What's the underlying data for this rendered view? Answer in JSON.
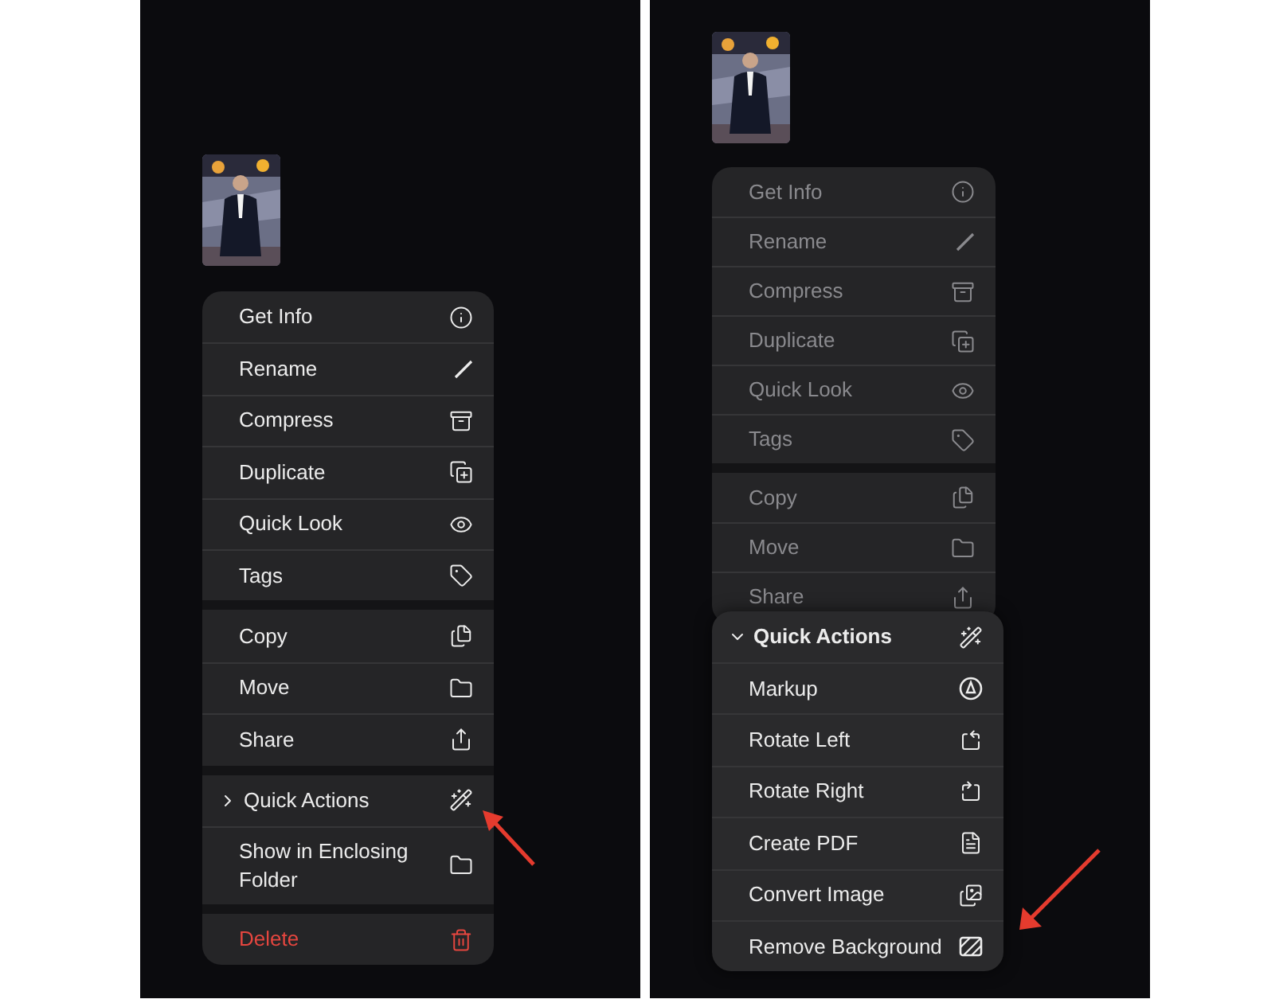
{
  "panels": [
    {
      "menu": {
        "dimmed": false,
        "groups": [
          [
            {
              "label": "Get Info",
              "kind": "action"
            },
            {
              "label": "Rename",
              "kind": "action"
            },
            {
              "label": "Compress",
              "kind": "action"
            },
            {
              "label": "Duplicate",
              "kind": "action"
            },
            {
              "label": "Quick Look",
              "kind": "action"
            },
            {
              "label": "Tags",
              "kind": "action"
            }
          ],
          [
            {
              "label": "Copy",
              "kind": "action"
            },
            {
              "label": "Move",
              "kind": "action"
            },
            {
              "label": "Share",
              "kind": "action"
            }
          ],
          [
            {
              "label": "Quick Actions",
              "kind": "submenu",
              "expanded": false
            },
            {
              "label": "Show in Enclosing Folder",
              "kind": "action"
            }
          ],
          [
            {
              "label": "Delete",
              "kind": "destructive"
            }
          ]
        ]
      }
    },
    {
      "menu": {
        "dimmed": true,
        "groups": [
          [
            {
              "label": "Get Info",
              "kind": "action"
            },
            {
              "label": "Rename",
              "kind": "action"
            },
            {
              "label": "Compress",
              "kind": "action"
            },
            {
              "label": "Duplicate",
              "kind": "action"
            },
            {
              "label": "Quick Look",
              "kind": "action"
            },
            {
              "label": "Tags",
              "kind": "action"
            }
          ],
          [
            {
              "label": "Copy",
              "kind": "action"
            },
            {
              "label": "Move",
              "kind": "action"
            },
            {
              "label": "Share",
              "kind": "action"
            }
          ]
        ]
      },
      "submenu": {
        "label": "Quick Actions",
        "expanded": true,
        "items": [
          {
            "label": "Markup"
          },
          {
            "label": "Rotate Left"
          },
          {
            "label": "Rotate Right"
          },
          {
            "label": "Create PDF"
          },
          {
            "label": "Convert Image"
          },
          {
            "label": "Remove Background"
          }
        ]
      }
    }
  ]
}
